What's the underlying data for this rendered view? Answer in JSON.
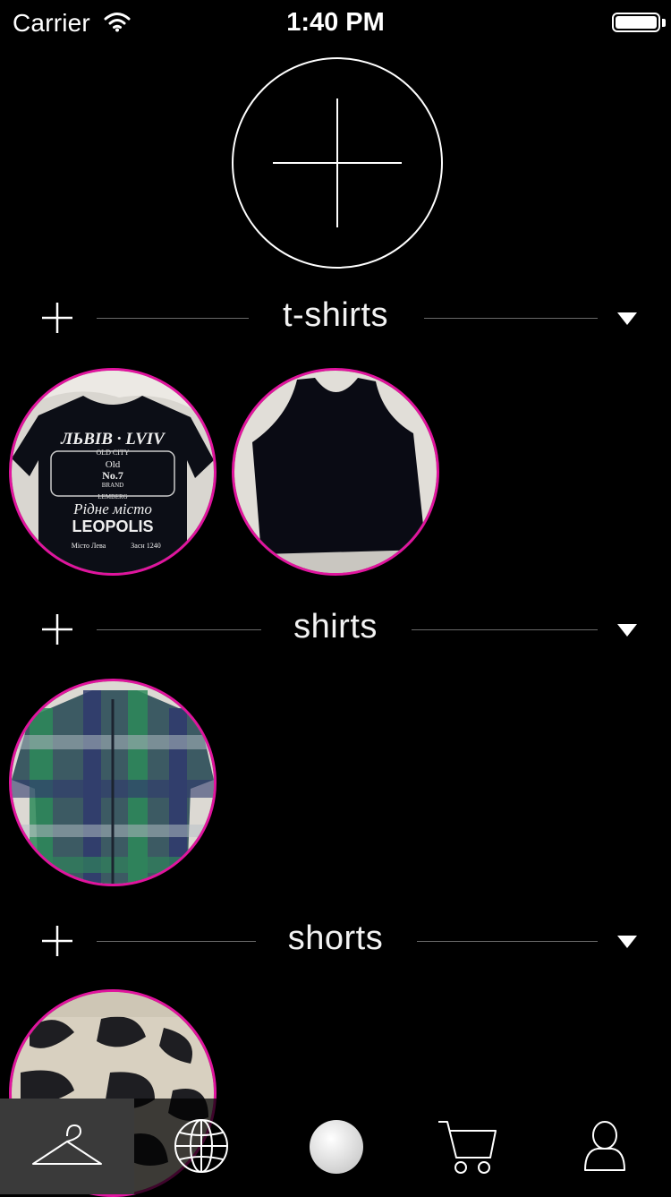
{
  "status_bar": {
    "carrier": "Carrier",
    "time": "1:40 PM"
  },
  "add_item": {
    "icon": "plus-icon"
  },
  "sections": [
    {
      "title": "t-shirts",
      "add_icon": "plus-icon",
      "toggle_icon": "triangle-down-icon",
      "items": [
        {
          "photo_lettering": [
            "ЛЬВІВ · LVIV",
            "OLD CITY",
            "Old",
            "No.7",
            "BRAND",
            "LEMBERG",
            "Рідне місто",
            "LEOPOLIS",
            "Місто Лева",
            "Засн 1240"
          ]
        },
        {
          "photo_lettering": []
        }
      ]
    },
    {
      "title": "shirts",
      "add_icon": "plus-icon",
      "toggle_icon": "triangle-down-icon",
      "items": [
        {
          "photo_lettering": []
        }
      ]
    },
    {
      "title": "shorts",
      "add_icon": "plus-icon",
      "toggle_icon": "triangle-down-icon",
      "items": [
        {
          "photo_lettering": []
        }
      ]
    }
  ],
  "tab_bar": {
    "tabs": [
      {
        "icon": "hanger-icon",
        "active": true
      },
      {
        "icon": "globe-icon",
        "active": false
      },
      {
        "icon": "ball-icon",
        "active": false
      },
      {
        "icon": "cart-icon",
        "active": false
      },
      {
        "icon": "person-icon",
        "active": false
      }
    ]
  },
  "colors": {
    "background": "#000000",
    "item_ring": "#e0149e",
    "active_tab": "#3a3a3a"
  }
}
